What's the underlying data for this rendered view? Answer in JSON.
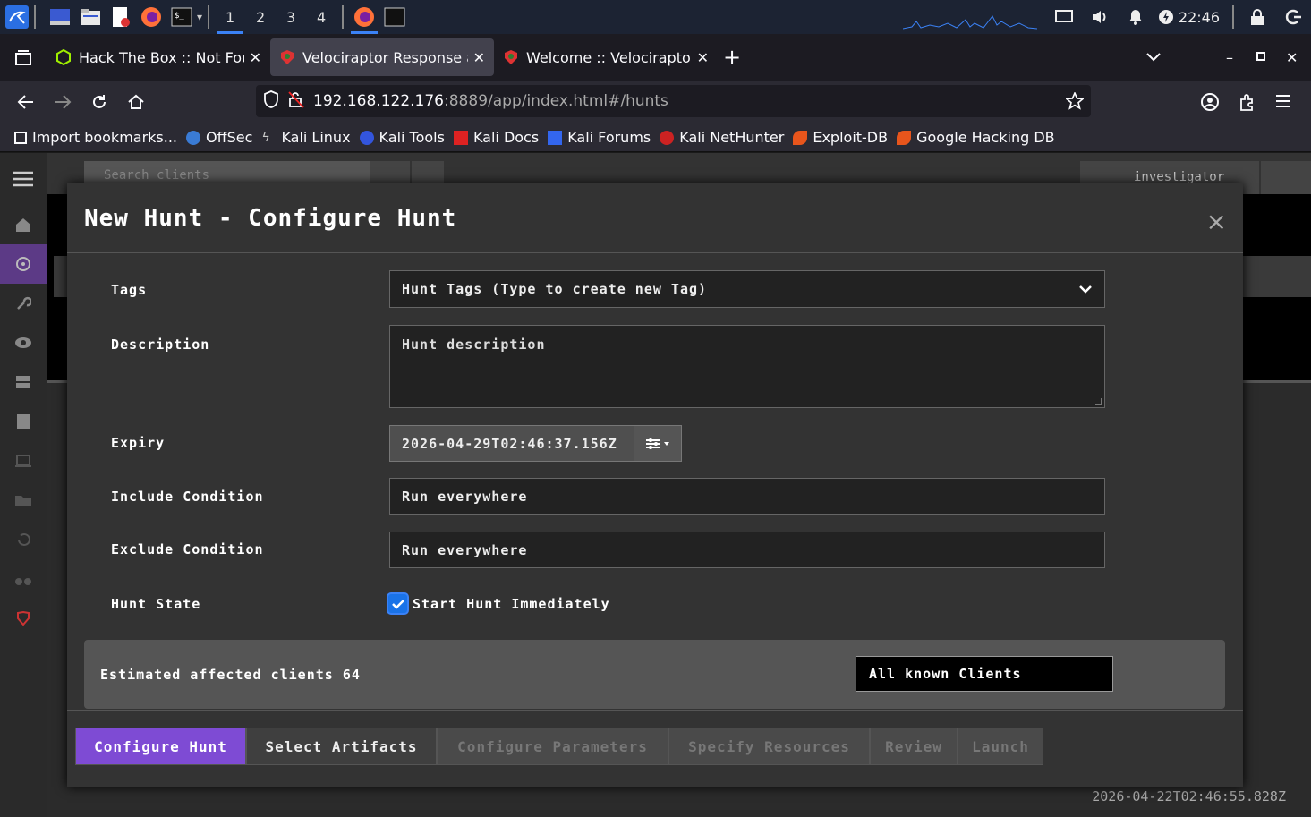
{
  "taskbar": {
    "workspaces": [
      "1",
      "2",
      "3",
      "4"
    ],
    "clock": "22:46"
  },
  "browser": {
    "tabs": [
      {
        "title": "Hack The Box :: Not Found",
        "active": false
      },
      {
        "title": "Velociraptor Response and",
        "active": true
      },
      {
        "title": "Welcome :: Velociraptor -",
        "active": false
      }
    ],
    "url_host": "192.168.122.176",
    "url_rest": ":8889/app/index.html#/hunts",
    "bookmarks": [
      "Import bookmarks...",
      "OffSec",
      "Kali Linux",
      "Kali Tools",
      "Kali Docs",
      "Kali Forums",
      "Kali NetHunter",
      "Exploit-DB",
      "Google Hacking DB"
    ]
  },
  "app": {
    "search_placeholder": "Search clients",
    "username": "investigator",
    "bg_date": "2026-04-22T02:46:55.828Z"
  },
  "modal": {
    "title": "New Hunt - Configure Hunt",
    "close": "×",
    "labels": {
      "tags": "Tags",
      "description": "Description",
      "expiry": "Expiry",
      "include": "Include Condition",
      "exclude": "Exclude Condition",
      "state": "Hunt State"
    },
    "tags_placeholder": "Hunt Tags (Type to create new Tag)",
    "description_placeholder": "Hunt description",
    "expiry_value": "2026-04-29T02:46:37.156Z",
    "include_value": "Run everywhere",
    "exclude_value": "Run everywhere",
    "start_immediately_label": "Start Hunt Immediately",
    "start_immediately_checked": true,
    "estimated": "Estimated affected clients 64",
    "clients_select": "All known Clients",
    "steps": [
      "Configure Hunt",
      "Select Artifacts",
      "Configure Parameters",
      "Specify Resources",
      "Review",
      "Launch"
    ]
  }
}
